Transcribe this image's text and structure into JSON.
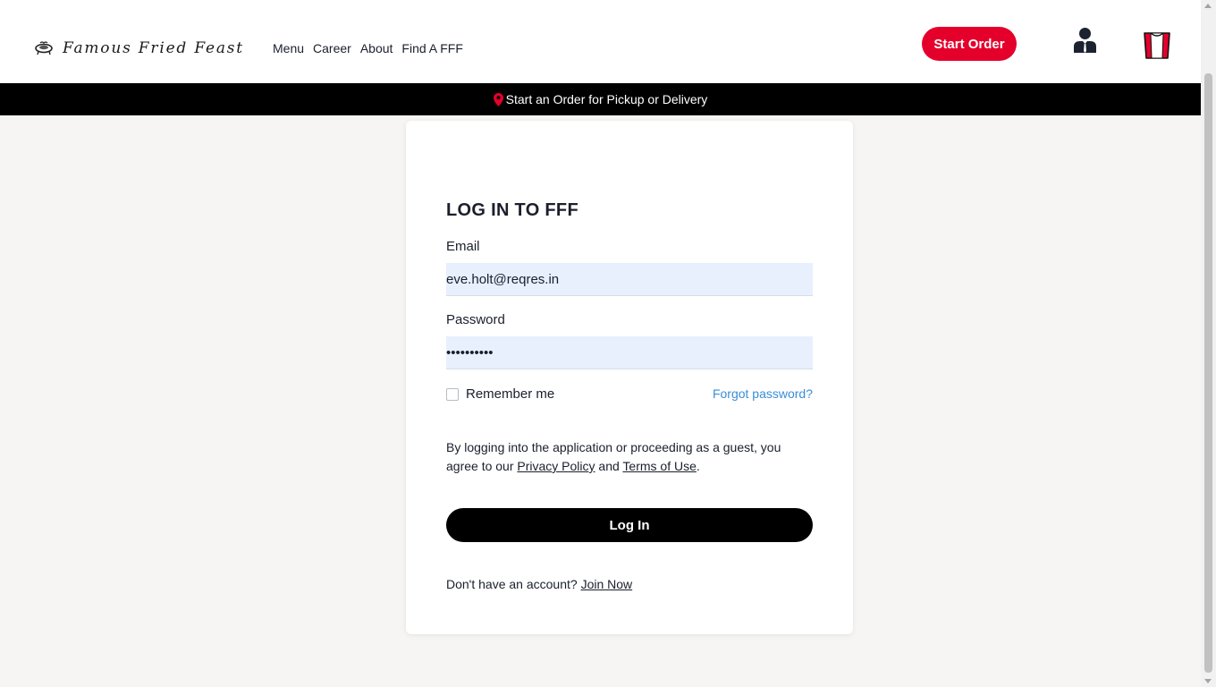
{
  "brand": {
    "name": "Famous Fried Feast",
    "accent_color": "#e4002b",
    "logo_icon": "fried-chicken-plate-icon"
  },
  "nav": {
    "items": [
      {
        "label": "Menu"
      },
      {
        "label": "Career"
      },
      {
        "label": "About"
      },
      {
        "label": "Find A FFF"
      }
    ]
  },
  "header": {
    "start_order_label": "Start Order",
    "account_icon": "user-account-icon",
    "cart_icon": "bucket-icon"
  },
  "promo": {
    "text": "Start an Order for Pickup or Delivery",
    "icon": "location-pin-icon"
  },
  "login": {
    "title": "LOG IN TO FFF",
    "email_label": "Email",
    "email_value": "eve.holt@reqres.in",
    "password_label": "Password",
    "password_value": "cityslicka",
    "remember_label": "Remember me",
    "remember_checked": false,
    "forgot_label": "Forgot password?",
    "terms_prefix": "By logging into the application or proceeding as a guest, you agree to our",
    "privacy_label": "Privacy Policy",
    "terms_and": "and",
    "terms_label": "Terms of Use",
    "terms_suffix": ".",
    "submit_label": "Log In",
    "signup_prompt": "Don't have an account?",
    "signup_label": "Join Now"
  }
}
